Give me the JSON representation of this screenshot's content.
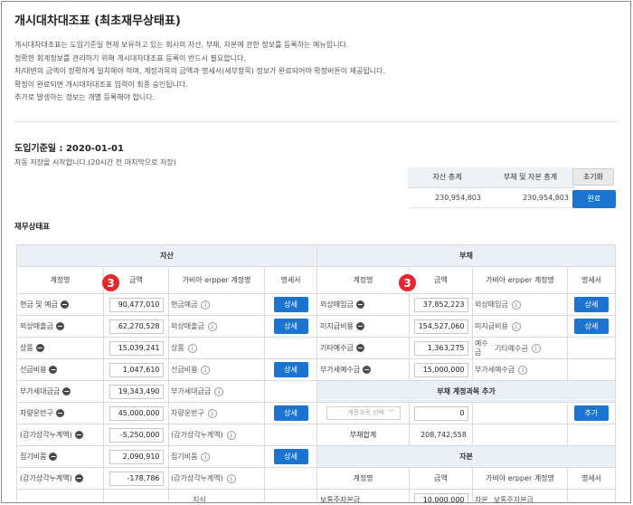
{
  "page": {
    "title": "개시대차대조표 (최초재무상태표)",
    "description": [
      "개시대차대조표는 도입기준일 현재 보유하고 있는 회사의 자산, 부채, 자본에 관한 정보를 등록하는 메뉴입니다.",
      "정확한 회계정보를 관리하기 위해 개시대차대조표 등록이 반드시 필요합니다.",
      "차/대변의 금액이 정확하게 일치해야 하며, 계정과목의 금액과 명세서(세부항목) 정보가 완료되어야 확정버튼이 제공됩니다.",
      "확정이 완료되면 개시대차대조표 입력이 최종 승인됩니다.",
      "추가로 발생하는 정보는 개별 등록해야 합니다."
    ],
    "base_date": "도입기준일 : 2020-01-01",
    "autosave_text": "자동 저장을 시작합니다.(20시간 전 마지막으로 저장)"
  },
  "summary": {
    "asset_total_label": "자산 총계",
    "liab_total_label": "부채 및 자본 총계",
    "asset_total_value": "230,954,803",
    "liab_total_value": "230,954,803",
    "reset_label": "초기화",
    "done_label": "완료"
  },
  "section_title": "재무상태표",
  "grid": {
    "asset_header": "자산",
    "liab_header": "부채",
    "equity_header": "자본",
    "col_account": "계정명",
    "col_amount": "금액",
    "col_erp": "가비아 erpper 계정명",
    "col_statement": "명세서",
    "detail_label": "상세",
    "add_label": "추가",
    "liab_add_title": "부채 계정과목 추가",
    "liab_add_placeholder": "계정과목 선택",
    "liab_add_amount": "0",
    "liab_total_label": "부채합계",
    "liab_total_value": "208,742,558",
    "badge_number": "3",
    "assets": [
      {
        "name": "현금 및 예금",
        "amount": "90,477,010",
        "erp": "현금예금",
        "detail": true
      },
      {
        "name": "외상매출금",
        "amount": "62,270,528",
        "erp": "외상매출금",
        "detail": true
      },
      {
        "name": "상품",
        "amount": "15,039,241",
        "erp": "상품",
        "detail": false
      },
      {
        "name": "선급비용",
        "amount": "1,047,610",
        "erp": "선급비용",
        "detail": true
      },
      {
        "name": "부가세대급금",
        "amount": "19,343,490",
        "erp": "부가세대급금",
        "detail": false
      },
      {
        "name": "차량운반구",
        "amount": "45,000,000",
        "erp": "차량운반구",
        "detail": true
      },
      {
        "name": "(감가상각누계액)",
        "amount": "-5,250,000",
        "erp": "(감가상각누계액)",
        "detail": false
      },
      {
        "name": "집기비품",
        "amount": "2,090,910",
        "erp": "집기비품",
        "detail": true
      },
      {
        "name": "(감가상각누계액)",
        "amount": "-178,786",
        "erp": "(감가상각누계액)",
        "detail": false
      },
      {
        "name": "",
        "amount": "",
        "erp": "지식",
        "detail": false
      }
    ],
    "liabilities": [
      {
        "name": "외상매입금",
        "amount": "37,852,223",
        "erp": "외상매입금",
        "erp_prefix": "",
        "detail": true
      },
      {
        "name": "미지급비용",
        "amount": "154,527,060",
        "erp": "미지급비용",
        "erp_prefix": "",
        "detail": true
      },
      {
        "name": "기타예수금",
        "amount": "1,363,275",
        "erp": "기타예수금",
        "erp_prefix": "예수금",
        "detail": false
      },
      {
        "name": "부가세예수금",
        "amount": "15,000,000",
        "erp": "부가세예수금",
        "erp_prefix": "",
        "detail": false
      }
    ],
    "equity": [
      {
        "name": "보통주자본금",
        "amount": "10,000,000",
        "erp": "보통주자본금",
        "erp_prefix": "자본"
      }
    ]
  }
}
